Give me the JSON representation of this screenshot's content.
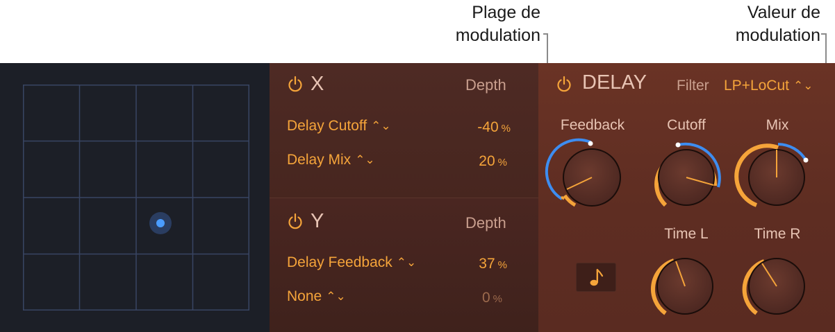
{
  "callouts": {
    "range": {
      "line1": "Plage de",
      "line2": "modulation"
    },
    "value": {
      "line1": "Valeur de",
      "line2": "modulation"
    }
  },
  "xy_pad": {
    "puck_color": "#4a9cff",
    "grid_color": "#384563"
  },
  "x_panel": {
    "title": "X",
    "depth_header": "Depth",
    "rows": [
      {
        "target": "Delay Cutoff",
        "value": "-40",
        "unit": "%"
      },
      {
        "target": "Delay Mix",
        "value": "20",
        "unit": "%"
      }
    ]
  },
  "y_panel": {
    "title": "Y",
    "depth_header": "Depth",
    "rows": [
      {
        "target": "Delay Feedback",
        "value": "37",
        "unit": "%"
      },
      {
        "target": "None",
        "value": "0",
        "unit": "%"
      }
    ]
  },
  "delay": {
    "title": "DELAY",
    "filter_label": "Filter",
    "filter_value": "LP+LoCut",
    "knobs": {
      "feedback": "Feedback",
      "cutoff": "Cutoff",
      "mix": "Mix",
      "time_l": "Time L",
      "time_r": "Time R"
    },
    "sync_icon": "music-note-icon"
  },
  "colors": {
    "accent": "#f5a43a",
    "modulation": "#3d8df0"
  }
}
